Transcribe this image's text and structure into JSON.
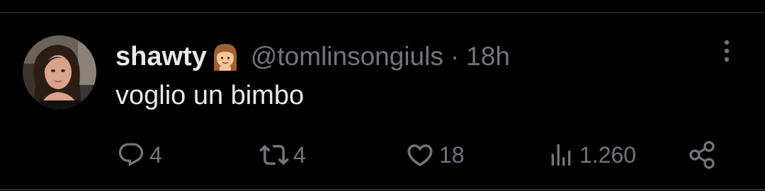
{
  "tweet": {
    "display_name": "shawty",
    "handle": "@tomlinsongiuls",
    "separator": "·",
    "time": "18h",
    "text": "voglio un bimbo",
    "avatar_icon": "profile-photo",
    "emoji_icon": "girl-emoji"
  },
  "actions": {
    "reply": {
      "icon": "reply-icon",
      "count": "4"
    },
    "retweet": {
      "icon": "retweet-icon",
      "count": "4"
    },
    "like": {
      "icon": "heart-icon",
      "count": "18"
    },
    "views": {
      "icon": "views-icon",
      "count": "1.260"
    },
    "share": {
      "icon": "share-icon"
    }
  },
  "colors": {
    "background": "#000000",
    "primary_text": "#e7e9ea",
    "secondary_text": "#71767b",
    "divider": "#2f3336"
  }
}
